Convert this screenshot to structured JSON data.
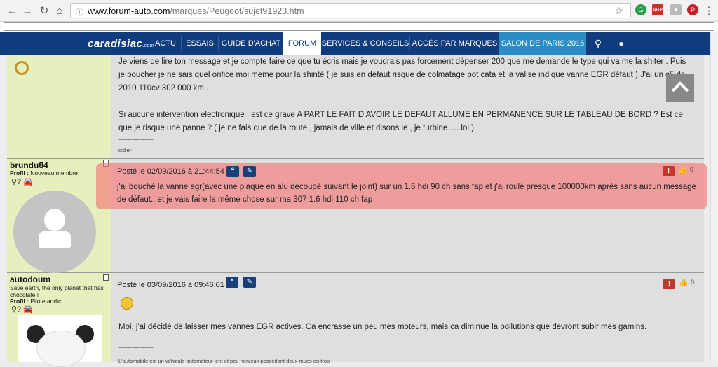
{
  "browser": {
    "url_domain": "www.forum-auto.com",
    "url_path": "/marques/Peugeot/sujet91923.htm"
  },
  "nav": {
    "logo": "caradisiac",
    "logo_suffix": ".com",
    "items": [
      {
        "label": "ACTU"
      },
      {
        "label": "ESSAIS"
      },
      {
        "label": "GUIDE D'ACHAT"
      },
      {
        "label": "FORUM"
      },
      {
        "label": "SERVICES & CONSEILS"
      },
      {
        "label": "ACCÈS PAR MARQUES"
      },
      {
        "label": "SALON DE PARIS 2016"
      }
    ]
  },
  "posts": [
    {
      "lines": [
        "Je viens de lire ton message et je compte faire ce que tu écris mais je voudrais pas forcement dépenser 200 que me demande le type qui va me la shiter . Puis",
        "je boucher je ne sais quel orifice moi meme pour la shinté ( je suis en défaut risque de colmatage pot cata et la valise indique vanne EGR défaut ) J'ai un c5 de",
        "2010 110cv 302 000 km .",
        "",
        "Si aucune intervention electronique , est ce grave A PART LE FAIT D AVOIR LE DEFAUT ALLUME EN PERMANENCE SUR LE TABLEAU DE BORD ? Est ce",
        "que je risque une panne ? ( je ne fais que de la route , jamais de ville et disons le , je turbine .....lol )"
      ],
      "signature_line": "---------------",
      "signature": "didier"
    },
    {
      "username": "brundu84",
      "profile_label": "Profil :",
      "profile_value": "Nouveau membre",
      "posted": "Posté le 02/09/2016 à 21:44:54",
      "likes": "0",
      "lines": [
        "j'ai bouché la vanne egr(avec une plaque en alu découpé suivant le joint) sur un 1.6 hdi 90 ch sans fap et j'ai roulé presque 100000km après sans aucun message",
        "de défaut.. et je vais faire la même chose sur ma 307 1.6 hdi 110 ch fap"
      ]
    },
    {
      "username": "autodoum",
      "motto": "Save earth, the only planet that has chocolate !",
      "profile_label": "Profil :",
      "profile_value": "Pilote addict",
      "posted": "Posté le 03/09/2016 à 09:46:01",
      "likes": "0",
      "lines": [
        "Moi, j'ai décidé de laisser mes vannes EGR actives. Ca encrasse un peu mes moteurs, mais ca diminue la pollutions que devront subir mes gamins."
      ],
      "signature_line": "---------------",
      "signature": "L'automobile est un véhicule automoteur lent et peu nerveux possédant deux mues en trop"
    }
  ]
}
